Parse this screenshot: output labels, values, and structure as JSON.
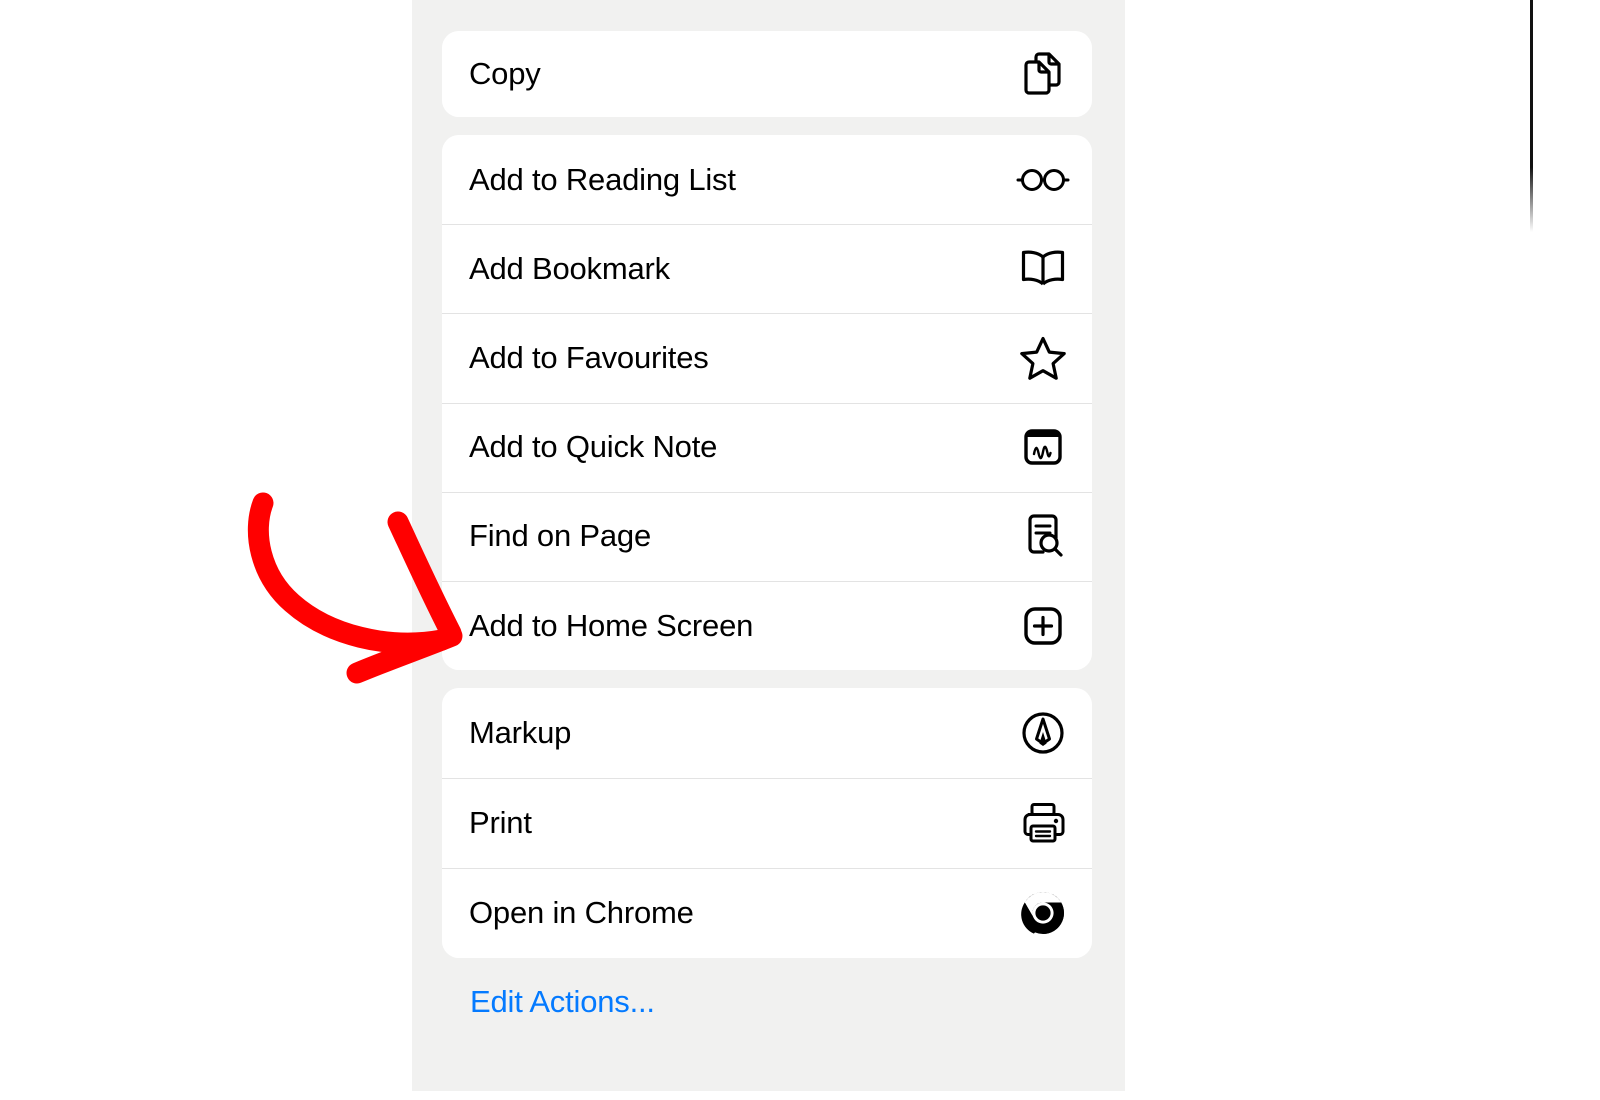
{
  "screen": {
    "type": "ios-share-sheet",
    "background_color": "#ffffff",
    "panel_color": "#f1f1f0",
    "card_color": "#ffffff",
    "separator_color": "#e3e3e3",
    "text_color": "#000000",
    "accent_color": "#047aff",
    "annotation_color": "#ff0000"
  },
  "share_sheet": {
    "groups": [
      {
        "name": "clipboard-group",
        "items": [
          {
            "label": "Copy",
            "icon": "copy-icon"
          }
        ]
      },
      {
        "name": "actions-group",
        "items": [
          {
            "label": "Add to Reading List",
            "icon": "glasses-icon"
          },
          {
            "label": "Add Bookmark",
            "icon": "book-icon"
          },
          {
            "label": "Add to Favourites",
            "icon": "star-icon"
          },
          {
            "label": "Add to Quick Note",
            "icon": "quick-note-icon"
          },
          {
            "label": "Find on Page",
            "icon": "document-search-icon"
          },
          {
            "label": "Add to Home Screen",
            "icon": "plus-square-icon"
          }
        ]
      },
      {
        "name": "tools-group",
        "items": [
          {
            "label": "Markup",
            "icon": "markup-pen-icon"
          },
          {
            "label": "Print",
            "icon": "printer-icon"
          },
          {
            "label": "Open in Chrome",
            "icon": "chrome-icon"
          }
        ]
      }
    ],
    "edit_actions_label": "Edit Actions..."
  },
  "annotation": {
    "name": "red-arrow",
    "shape": "hand-drawn curved arrow",
    "color": "#ff0000",
    "points_to": "Add to Home Screen"
  }
}
